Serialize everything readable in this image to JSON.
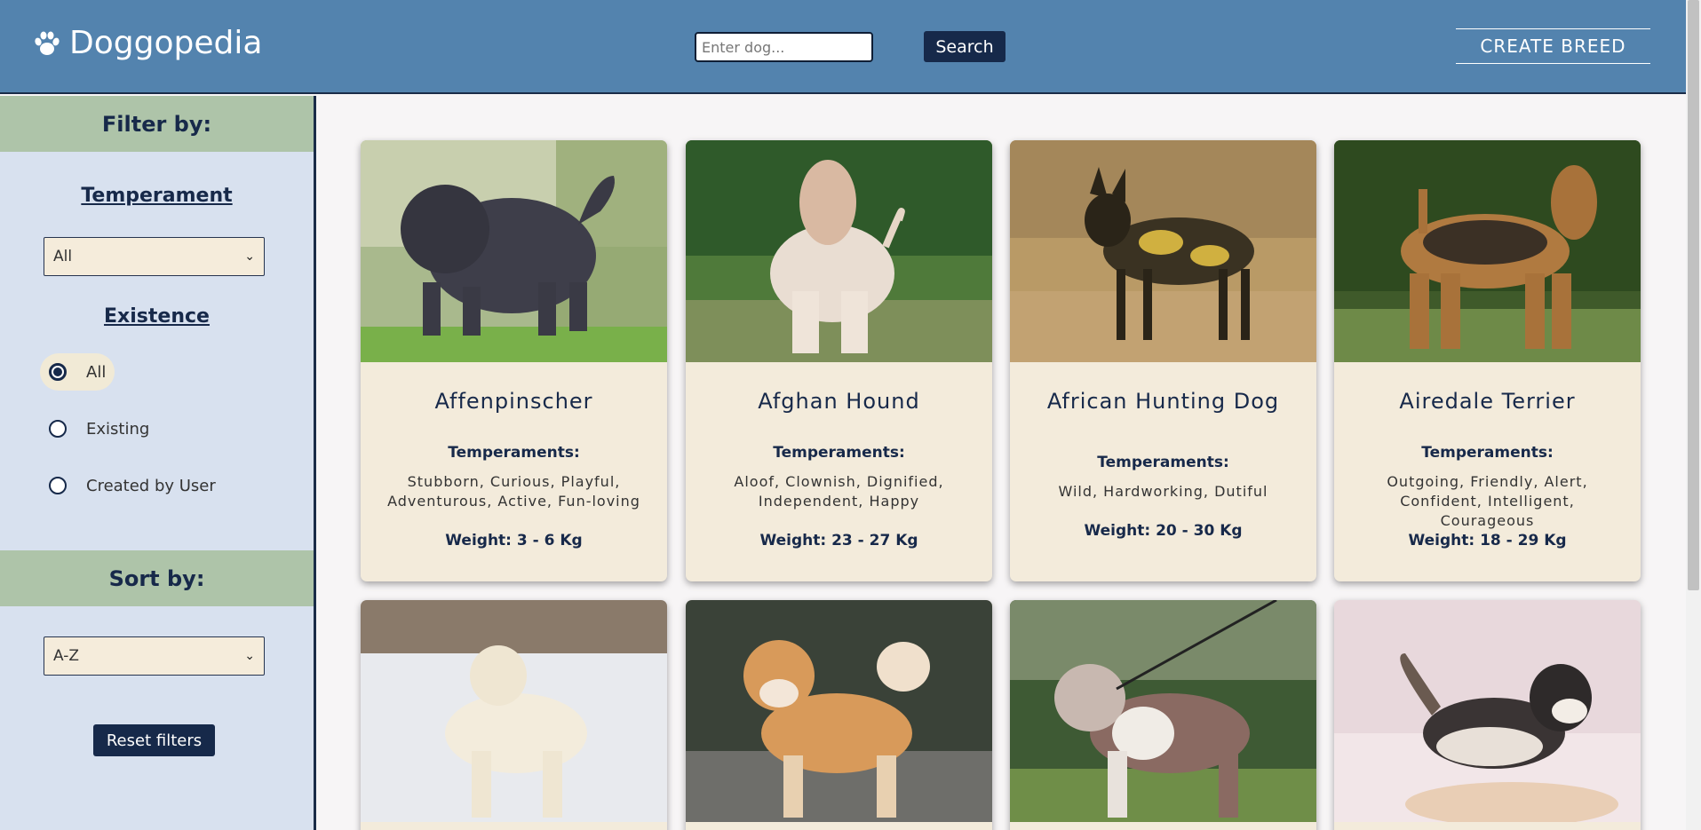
{
  "header": {
    "logo_text": "Doggopedia",
    "logo_icon": "paw-icon",
    "search_placeholder": "Enter dog...",
    "search_label": "Search",
    "create_label": "CREATE BREED"
  },
  "sidebar": {
    "filter_title": "Filter by:",
    "temperament_label": "Temperament",
    "temperament_selected": "All",
    "existence_label": "Existence",
    "existence_options": [
      "All",
      "Existing",
      "Created by User"
    ],
    "existence_selected": "All",
    "sort_title": "Sort by:",
    "sort_selected": "A-Z",
    "reset_label": "Reset filters"
  },
  "labels": {
    "temperaments": "Temperaments:"
  },
  "breeds": [
    {
      "name": "Affenpinscher",
      "temperaments": "Stubborn, Curious, Playful, Adventurous, Active, Fun-loving",
      "weight": "Weight: 3 - 6 Kg"
    },
    {
      "name": "Afghan Hound",
      "temperaments": "Aloof, Clownish, Dignified, Independent, Happy",
      "weight": "Weight: 23 - 27 Kg"
    },
    {
      "name": "African Hunting Dog",
      "temperaments": "Wild, Hardworking, Dutiful",
      "weight": "Weight: 20 - 30 Kg"
    },
    {
      "name": "Airedale Terrier",
      "temperaments": "Outgoing, Friendly, Alert, Confident, Intelligent, Courageous",
      "weight": "Weight: 18 - 29 Kg"
    }
  ],
  "colors": {
    "header_bg": "#5383ae",
    "navy": "#16294a",
    "sidebar_bg": "#d8e1ef",
    "section_green": "#aec4a9",
    "card_bg": "#f3ebdb"
  }
}
